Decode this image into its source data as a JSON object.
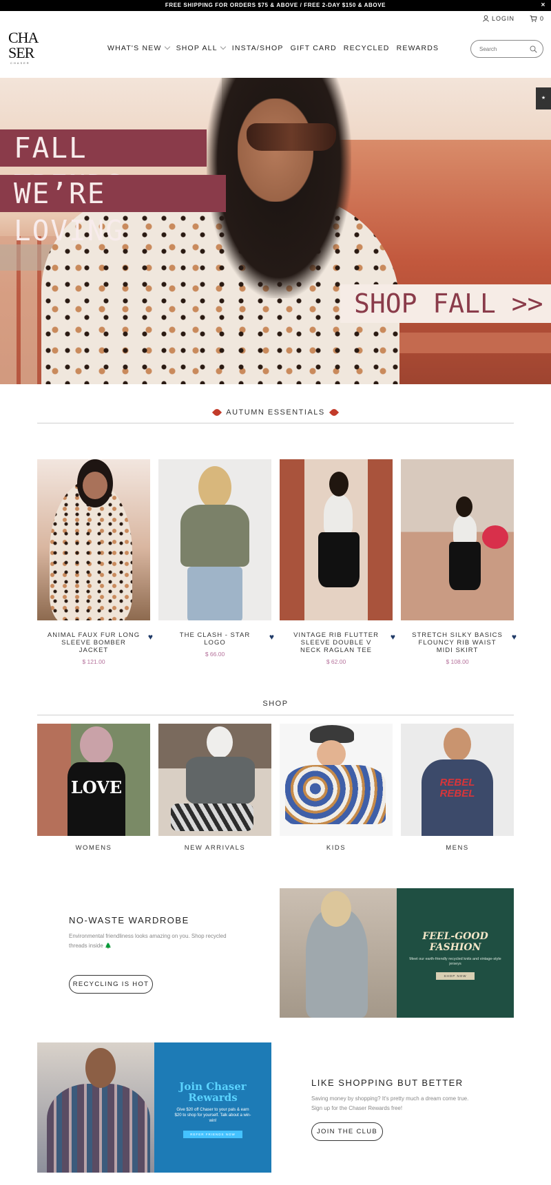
{
  "announcement": {
    "text": "FREE SHIPPING FOR ORDERS $75 & ABOVE / FREE 2-DAY $150 & ABOVE",
    "close": "×"
  },
  "brand": {
    "logo_text": "CHA\nSER",
    "logo_sub": "CHASER"
  },
  "header": {
    "login_label": "LOGIN",
    "cart_count": "0",
    "search_placeholder": "Search",
    "nav": [
      {
        "label": "WHAT'S NEW",
        "dropdown": true
      },
      {
        "label": "SHOP ALL",
        "dropdown": true
      },
      {
        "label": "INSTA/SHOP",
        "dropdown": false
      },
      {
        "label": "GIFT CARD",
        "dropdown": false
      },
      {
        "label": "RECYCLED",
        "dropdown": false
      },
      {
        "label": "REWARDS",
        "dropdown": false
      }
    ]
  },
  "hero": {
    "line1": "FALL TRENDS",
    "line2": "WE’RE LOVING",
    "cta": "SHOP FALL >>",
    "colors": {
      "banner": "#8a3b4a",
      "cta_bg": "#f6ece6"
    }
  },
  "essentials": {
    "title": "AUTUMN ESSENTIALS",
    "products": [
      {
        "name": "ANIMAL FAUX FUR LONG SLEEVE BOMBER JACKET",
        "price": "$ 121.00"
      },
      {
        "name": "THE CLASH - STAR LOGO",
        "price": "$ 66.00"
      },
      {
        "name": "VINTAGE RIB FLUTTER SLEEVE DOUBLE V NECK RAGLAN TEE",
        "price": "$ 62.00"
      },
      {
        "name": "STRETCH SILKY BASICS FLOUNCY RIB WAIST MIDI SKIRT",
        "price": "$ 108.00"
      }
    ]
  },
  "shop": {
    "title": "SHOP",
    "categories": [
      {
        "label": "WOMENS",
        "shirt_text": "LOVE"
      },
      {
        "label": "NEW ARRIVALS"
      },
      {
        "label": "KIDS"
      },
      {
        "label": "MENS",
        "shirt_text": "REBEL REBEL"
      }
    ]
  },
  "no_waste": {
    "title": "NO-WASTE WARDROBE",
    "text": "Environmental friendliness looks amazing on you. Shop recycled threads inside 🌲",
    "button": "RECYCLING IS HOT",
    "promo_heading": "FEEL-GOOD FASHION",
    "promo_text": "Meet our earth-friendly recycled knits and vintage-style jerseys",
    "promo_button": "SHOP NOW"
  },
  "club": {
    "promo_heading": "Join Chaser Rewards",
    "promo_text": "Give $20 off Chaser to your pals & earn $20 to shop for yourself. Talk about a win-win!",
    "promo_button": "REFER FRIENDS NOW",
    "title": "LIKE SHOPPING BUT BETTER",
    "text": "Saving money by shopping? It's pretty much a dream come true. Sign up for the Chaser Rewards free!",
    "button": "JOIN THE CLUB"
  }
}
